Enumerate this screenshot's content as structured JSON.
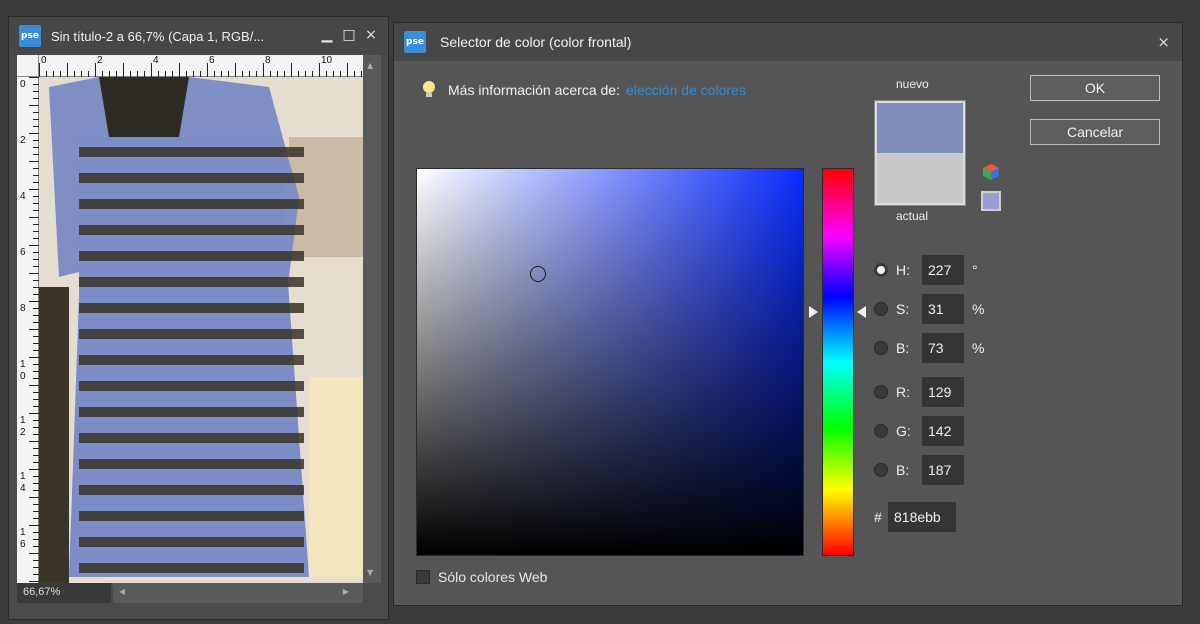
{
  "document_window": {
    "app_icon": "pse-logo",
    "logo_text": "pse",
    "title": "Sin título-2 a 66,7% (Capa 1, RGB/...",
    "minimize": "▁",
    "maximize": "□",
    "close": "×",
    "ruler_top_ticks": [
      "0",
      "2",
      "4",
      "6",
      "8",
      "10"
    ],
    "ruler_left_ticks": [
      "0",
      "2",
      "4",
      "6",
      "8",
      "1\n0",
      "1\n2",
      "1\n4",
      "1\n6"
    ],
    "zoom": "66,67%",
    "image": "dress-photo"
  },
  "dialog": {
    "logo_text": "pse",
    "title": "Selector de color (color frontal)",
    "close": "×",
    "info_label": "Más información acerca de:",
    "info_link": "elección de colores",
    "swatch_new_label": "nuevo",
    "swatch_current_label": "actual",
    "ok_label": "OK",
    "cancel_label": "Cancelar",
    "fields": [
      {
        "key": "H",
        "label": "H:",
        "value": "227",
        "unit": "°",
        "selected": true
      },
      {
        "key": "S",
        "label": "S:",
        "value": "31",
        "unit": "%",
        "selected": false
      },
      {
        "key": "Bv",
        "label": "B:",
        "value": "73",
        "unit": "%",
        "selected": false
      },
      {
        "key": "R",
        "label": "R:",
        "value": "129",
        "unit": "",
        "selected": false
      },
      {
        "key": "G",
        "label": "G:",
        "value": "142",
        "unit": "",
        "selected": false
      },
      {
        "key": "Bb",
        "label": "B:",
        "value": "187",
        "unit": "",
        "selected": false
      }
    ],
    "hex_label": "#",
    "hex_value": "818ebb",
    "websafe_label": "Sólo colores Web",
    "colors": {
      "new": "#818ebb",
      "current": "#c8c8c8",
      "hue_base": "#0a2cff"
    }
  }
}
